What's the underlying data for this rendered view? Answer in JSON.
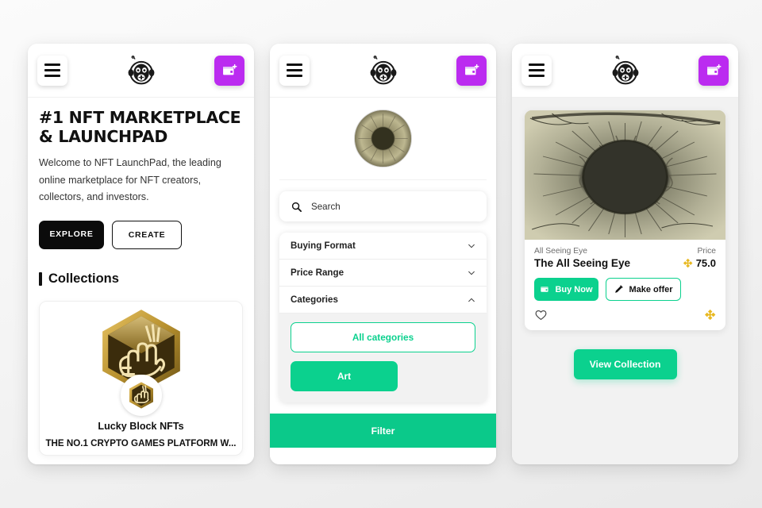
{
  "theme": {
    "green": "#0bd18e",
    "green_dark": "#0bc98a",
    "purple": "#bb2bf0",
    "black": "#0b0b0b",
    "gold": "#e8b923",
    "page_background": "#f1f1f1"
  },
  "header": {
    "menu_icon": "hamburger-icon",
    "logo_icon": "ape-headphones-logo",
    "wallet_icon": "wallet-add-icon"
  },
  "screen_home": {
    "hero": {
      "title": "#1 NFT MARKETPLACE & LAUNCHPAD",
      "subtitle": "Welcome to NFT LaunchPad, the leading online marketplace for NFT creators, collectors, and investors.",
      "primary_button": "EXPLORE",
      "secondary_button": "CREATE"
    },
    "section_title": "Collections",
    "collection": {
      "banner_icon": "lucky-block-hexagon-logo",
      "avatar_icon": "lucky-block-avatar",
      "name": "Lucky Block NFTs",
      "description": "THE NO.1 CRYPTO GAMES PLATFORM W..."
    }
  },
  "screen_filter": {
    "avatar_icon": "eye-avatar",
    "search": {
      "icon": "search-icon",
      "placeholder": "Search",
      "value": ""
    },
    "filters": [
      {
        "label": "Buying Format",
        "state": "collapsed",
        "chevron": "chevron-down-icon"
      },
      {
        "label": "Price Range",
        "state": "collapsed",
        "chevron": "chevron-down-icon"
      },
      {
        "label": "Categories",
        "state": "expanded",
        "chevron": "chevron-up-icon"
      }
    ],
    "categories": [
      {
        "label": "All categories",
        "selected": false
      },
      {
        "label": "Art",
        "selected": true
      }
    ],
    "submit_button": "Filter"
  },
  "screen_detail": {
    "nft": {
      "image_icon": "all-seeing-eye-artwork",
      "collection": "All Seeing Eye",
      "price_label": "Price",
      "title": "The All Seeing Eye",
      "price": "75.0",
      "currency_icon": "bnb-icon",
      "buy_button": "Buy Now",
      "buy_icon": "wallet-icon",
      "offer_button": "Make offer",
      "offer_icon": "pencil-icon",
      "favorite_icon": "heart-icon",
      "chain_icon": "bnb-icon"
    },
    "view_collection_button": "View Collection"
  }
}
